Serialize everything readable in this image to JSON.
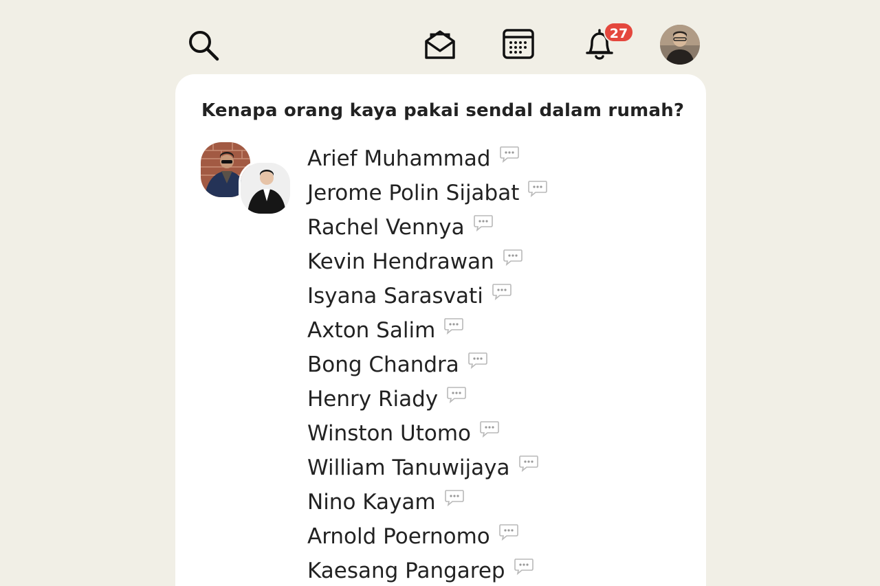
{
  "topbar": {
    "search_icon": "search-icon",
    "mail_icon": "envelope-open-icon",
    "calendar_icon": "calendar-icon",
    "bell_icon": "bell-icon",
    "notification_count": "27",
    "badge_color": "#e4473d"
  },
  "room": {
    "title": "Kenapa orang kaya pakai sendal dalam rumah?",
    "speakers": [
      {
        "name": "Arief Muhammad"
      },
      {
        "name": "Jerome Polin Sijabat"
      },
      {
        "name": "Rachel Vennya"
      },
      {
        "name": "Kevin Hendrawan"
      },
      {
        "name": "Isyana Sarasvati"
      },
      {
        "name": "Axton Salim"
      },
      {
        "name": "Bong Chandra"
      },
      {
        "name": "Henry Riady"
      },
      {
        "name": "Winston Utomo"
      },
      {
        "name": "William Tanuwijaya"
      },
      {
        "name": "Nino Kayam"
      },
      {
        "name": "Arnold Poernomo"
      },
      {
        "name": "Kaesang Pangarep"
      }
    ],
    "chat_icon": "speech-bubble-icon"
  },
  "colors": {
    "background": "#f1efe6",
    "card": "#ffffff",
    "text": "#222222"
  }
}
